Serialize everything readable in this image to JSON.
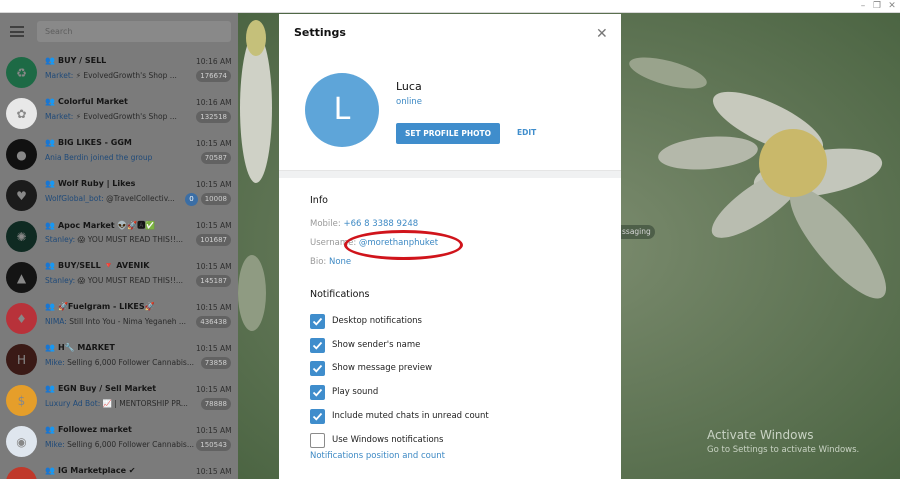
{
  "window": {
    "minimize": "–",
    "restore": "❐",
    "close": "✕"
  },
  "sidebar": {
    "search_placeholder": "Search",
    "chats": [
      {
        "name": "BUY / SELL",
        "time": "10:16 AM",
        "sender": "Market:",
        "preview": " ⚡ EvolvedGrowth's Shop ...",
        "badge": "176674",
        "avatar_color": "#1d6a45",
        "avatar_glyph": "♻"
      },
      {
        "name": "Colorful Market",
        "time": "10:16 AM",
        "sender": "Market:",
        "preview": " ⚡ EvolvedGrowth's Shop ...",
        "badge": "132518",
        "avatar_color": "#e8e8e8",
        "avatar_glyph": "✿"
      },
      {
        "name": "BIG LIKES - GGM",
        "time": "10:15 AM",
        "sender": "Ania Berdin joined the group",
        "preview": "",
        "badge": "70587",
        "avatar_color": "#111111",
        "avatar_glyph": "●"
      },
      {
        "name": "Wolf Ruby | Likes",
        "time": "10:15 AM",
        "sender": "WolfGlobal_bot:",
        "preview": " @TravelCollectiv...",
        "badge": "10008",
        "avatar_color": "#1b1b1b",
        "avatar_glyph": "♥",
        "pin": "0"
      },
      {
        "name": "Apoc Market 👽🚀🅰✅",
        "time": "10:15 AM",
        "sender": "Stanley:",
        "preview": " 😱 YOU MUST READ THIS!!...",
        "badge": "101687",
        "avatar_color": "#0f2a22",
        "avatar_glyph": "✺"
      },
      {
        "name": "BUY/SELL 🔻 AVENIK",
        "time": "10:15 AM",
        "sender": "Stanley:",
        "preview": " 😱 YOU MUST READ THIS!!...",
        "badge": "145187",
        "avatar_color": "#141414",
        "avatar_glyph": "▲"
      },
      {
        "name": "🚀Fuelgram - LIKES🚀",
        "time": "10:15 AM",
        "sender": "NIMA:",
        "preview": " Still Into You - Nima Yeganeh ...",
        "badge": "436438",
        "avatar_color": "#b8323a",
        "avatar_glyph": "♦"
      },
      {
        "name": "H🔧 MΔRKET",
        "time": "10:15 AM",
        "sender": "Mike:",
        "preview": " Selling 6,000 Follower Cannabis...",
        "badge": "73858",
        "avatar_color": "#3a1a16",
        "avatar_glyph": "H"
      },
      {
        "name": "EGN Buy / Sell Market",
        "time": "10:15 AM",
        "sender": "Luxury Ad Bot:",
        "preview": " 📈 | MENTORSHIP PR...",
        "badge": "78888",
        "avatar_color": "#e59e2a",
        "avatar_glyph": "$"
      },
      {
        "name": "Followez market",
        "time": "10:15 AM",
        "sender": "Mike:",
        "preview": " Selling 6,000 Follower Cannabis...",
        "badge": "150543",
        "avatar_color": "#dfe6ee",
        "avatar_glyph": "◉"
      },
      {
        "name": "IG Marketplace ✔",
        "time": "10:15 AM",
        "sender": "",
        "preview": "",
        "badge": "",
        "avatar_color": "#c0392b",
        "avatar_glyph": "◎"
      }
    ]
  },
  "background": {
    "pill": "ssaging",
    "activate_title": "Activate Windows",
    "activate_sub": "Go to Settings to activate Windows."
  },
  "settings": {
    "title": "Settings",
    "close": "✕",
    "profile": {
      "initial": "L",
      "name": "Luca",
      "status": "online",
      "set_photo": "SET PROFILE PHOTO",
      "edit": "EDIT"
    },
    "info": {
      "title": "Info",
      "mobile_label": "Mobile: ",
      "mobile": "+66 8 3388 9248",
      "username_label": "Username: ",
      "username": "@morethanphuket",
      "bio_label": "Bio: ",
      "bio": "None"
    },
    "notifications": {
      "title": "Notifications",
      "options": [
        {
          "label": "Desktop notifications",
          "checked": true
        },
        {
          "label": "Show sender's name",
          "checked": true
        },
        {
          "label": "Show message preview",
          "checked": true
        },
        {
          "label": "Play sound",
          "checked": true
        },
        {
          "label": "Include muted chats in unread count",
          "checked": true
        },
        {
          "label": "Use Windows notifications",
          "checked": false
        }
      ],
      "link": "Notifications position and count"
    }
  },
  "colors": {
    "accent": "#3f8dcc",
    "annotation": "#d0141b",
    "sidebar_dim": "#7b7b7b"
  }
}
